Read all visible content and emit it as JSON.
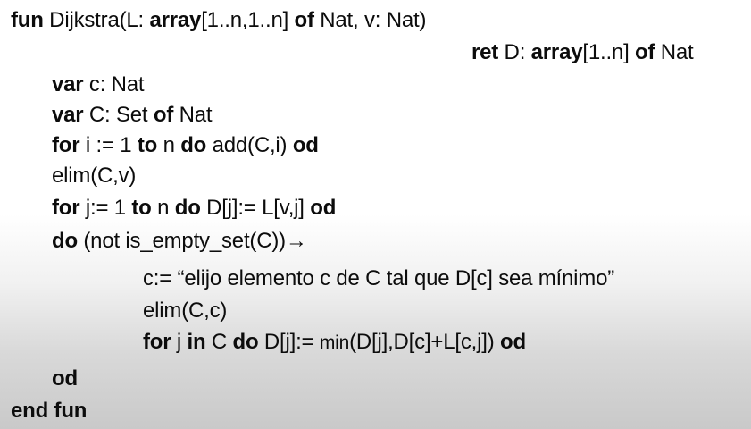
{
  "code": {
    "l1": [
      "fun",
      " Dijkstra(L: ",
      "array",
      "[1..n,1..n] ",
      "of",
      " Nat, v: Nat)"
    ],
    "l2": [
      "ret",
      " D: ",
      "array",
      "[1..n] ",
      "of",
      " Nat"
    ],
    "l3": [
      "var",
      " c: Nat"
    ],
    "l4": [
      "var",
      " C: Set ",
      "of",
      " Nat"
    ],
    "l5": [
      "for",
      " i := 1 ",
      "to",
      " n ",
      "do",
      " add(C,i) ",
      "od"
    ],
    "l6": [
      "elim(C,v)"
    ],
    "l7": [
      "for",
      " j:= 1 ",
      "to",
      " n ",
      "do",
      " D[j]:= L[v,j] ",
      "od"
    ],
    "l8": [
      "do",
      " (not is_empty_set(C))→"
    ],
    "l9": [
      "c:= “elijo elemento c de C tal que D[c] sea mínimo”"
    ],
    "l10": [
      "elim(C,c)"
    ],
    "l11": [
      "for",
      " j ",
      "in",
      " C ",
      "do",
      " D[j]:= ",
      "min",
      "(D[j],D[c]+L[c,j]) ",
      "od"
    ],
    "l12": [
      "od"
    ],
    "l13": [
      "end fun"
    ]
  }
}
